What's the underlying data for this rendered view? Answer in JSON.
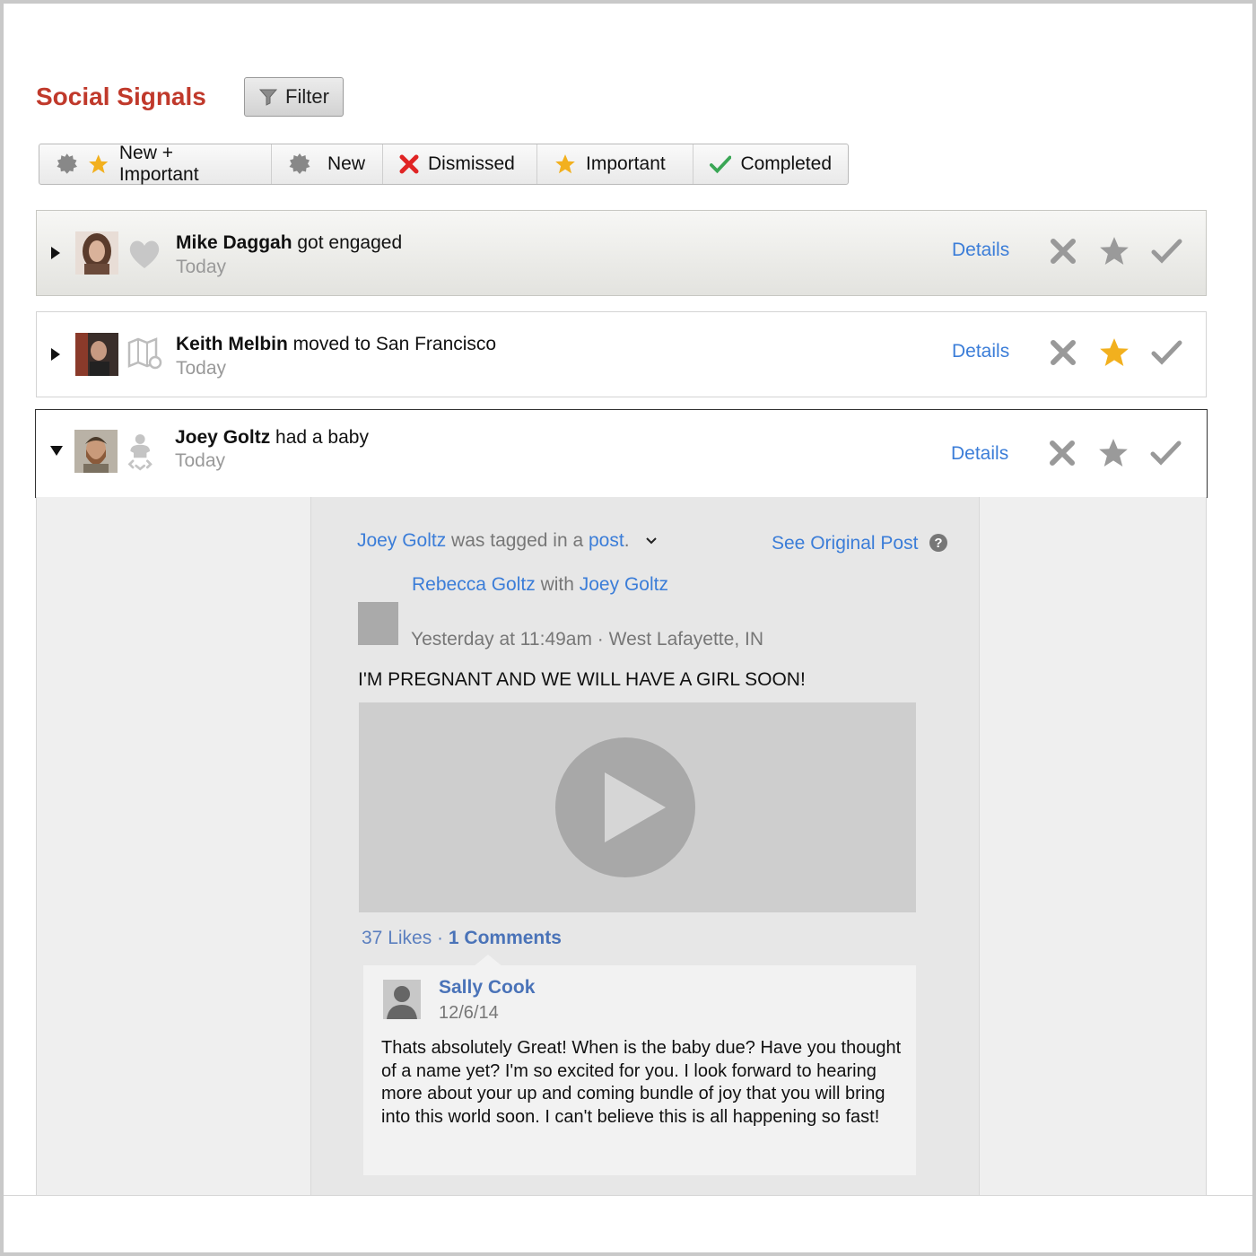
{
  "header": {
    "title": "Social Signals",
    "filter_label": "Filter"
  },
  "tabs": [
    {
      "label": "New + Important"
    },
    {
      "label": "New"
    },
    {
      "label": "Dismissed"
    },
    {
      "label": "Important"
    },
    {
      "label": "Completed"
    }
  ],
  "signals": [
    {
      "name": "Mike Daggah",
      "event": " got engaged",
      "when": "Today",
      "details": "Details",
      "category_icon": "heart-icon",
      "starred": false,
      "expanded": false
    },
    {
      "name": "Keith Melbin",
      "event": " moved to San Francisco",
      "when": "Today",
      "details": "Details",
      "category_icon": "map-pin-icon",
      "starred": true,
      "expanded": false
    },
    {
      "name": "Joey Goltz",
      "event": " had a baby",
      "when": "Today",
      "details": "Details",
      "category_icon": "baby-icon",
      "starred": false,
      "expanded": true
    }
  ],
  "post": {
    "tag_name": "Joey Goltz",
    "tag_mid": " was tagged in a ",
    "tag_link": "post",
    "tag_end": ".",
    "see_original": "See Original Post",
    "author": "Rebecca Goltz",
    "with_text": " with ",
    "with_name": "Joey Goltz",
    "meta": "Yesterday at 11:49am · West Lafayette, IN",
    "message": "I'M PREGNANT AND WE WILL HAVE A GIRL SOON!",
    "likes": "37 Likes",
    "sep": " · ",
    "comments": "1 Comments",
    "comment": {
      "author": "Sally Cook",
      "date": "12/6/14",
      "text": "Thats absolutely Great! When is the baby due? Have you thought of a name yet? I'm so excited for you. I look forward to hearing more about your up and coming bundle of joy that you will bring into this world soon. I can't believe this is all happening so fast!"
    }
  },
  "colors": {
    "title": "#c0392b",
    "link": "#3b7dd8",
    "star_active": "#f2b01e",
    "dismiss_red": "#e02424",
    "check_green": "#3aa655"
  }
}
